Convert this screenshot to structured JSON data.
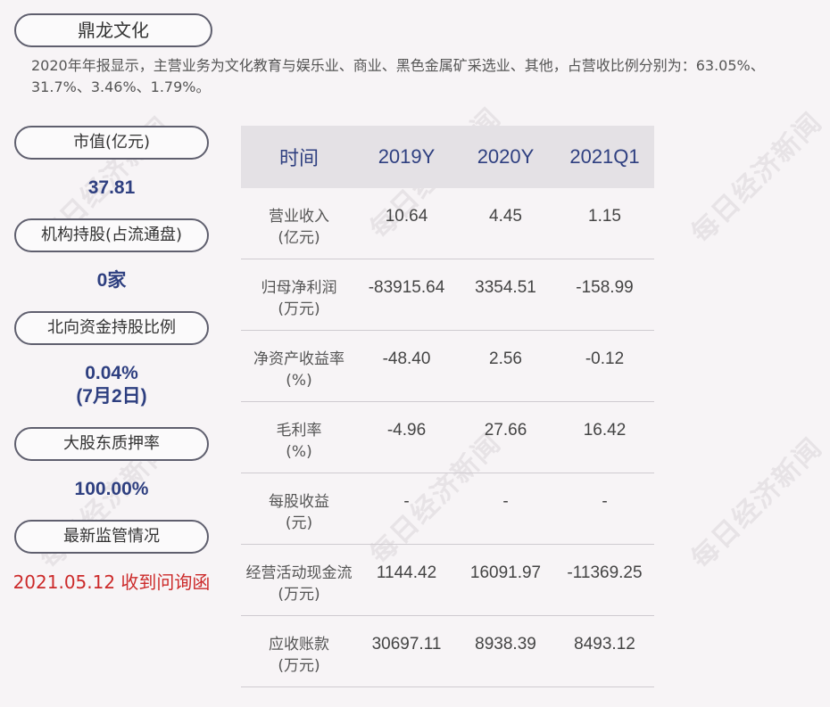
{
  "title": "鼎龙文化",
  "summary": "2020年年报显示，主营业务为文化教育与娱乐业、商业、黑色金属矿采选业、其他，占营收比例分别为：63.05%、31.7%、3.46%、1.79%。",
  "left_panel": {
    "market_cap_label": "市值(亿元)",
    "market_cap_value": "37.81",
    "institution_label": "机构持股(占流通盘)",
    "institution_value": "0家",
    "northbound_label": "北向资金持股比例",
    "northbound_value": "0.04%",
    "northbound_date": "(7月2日)",
    "pledge_label": "大股东质押率",
    "pledge_value": "100.00%",
    "regulation_label": "最新监管情况",
    "regulation_value": "2021.05.12 收到问询函"
  },
  "table": {
    "headers": [
      "时间",
      "2019Y",
      "2020Y",
      "2021Q1"
    ],
    "rows": [
      {
        "label": "营业收入",
        "unit": "(亿元)",
        "values": [
          "10.64",
          "4.45",
          "1.15"
        ]
      },
      {
        "label": "归母净利润",
        "unit": "(万元)",
        "values": [
          "-83915.64",
          "3354.51",
          "-158.99"
        ]
      },
      {
        "label": "净资产收益率",
        "unit": "(%)",
        "values": [
          "-48.40",
          "2.56",
          "-0.12"
        ]
      },
      {
        "label": "毛利率",
        "unit": "(%)",
        "values": [
          "-4.96",
          "27.66",
          "16.42"
        ]
      },
      {
        "label": "每股收益",
        "unit": "(元)",
        "values": [
          "-",
          "-",
          "-"
        ]
      },
      {
        "label": "经营活动现金流",
        "unit": "(万元)",
        "values": [
          "1144.42",
          "16091.97",
          "-11369.25"
        ]
      },
      {
        "label": "应收账款",
        "unit": "(万元)",
        "values": [
          "30697.11",
          "8938.39",
          "8493.12"
        ]
      }
    ]
  },
  "watermark": "每日经济新闻",
  "colors": {
    "accent_blue": "#2e3f80",
    "alert_red": "#cc2a2a",
    "background": "#f7f4f6",
    "header_bg": "#e4e1e5"
  }
}
